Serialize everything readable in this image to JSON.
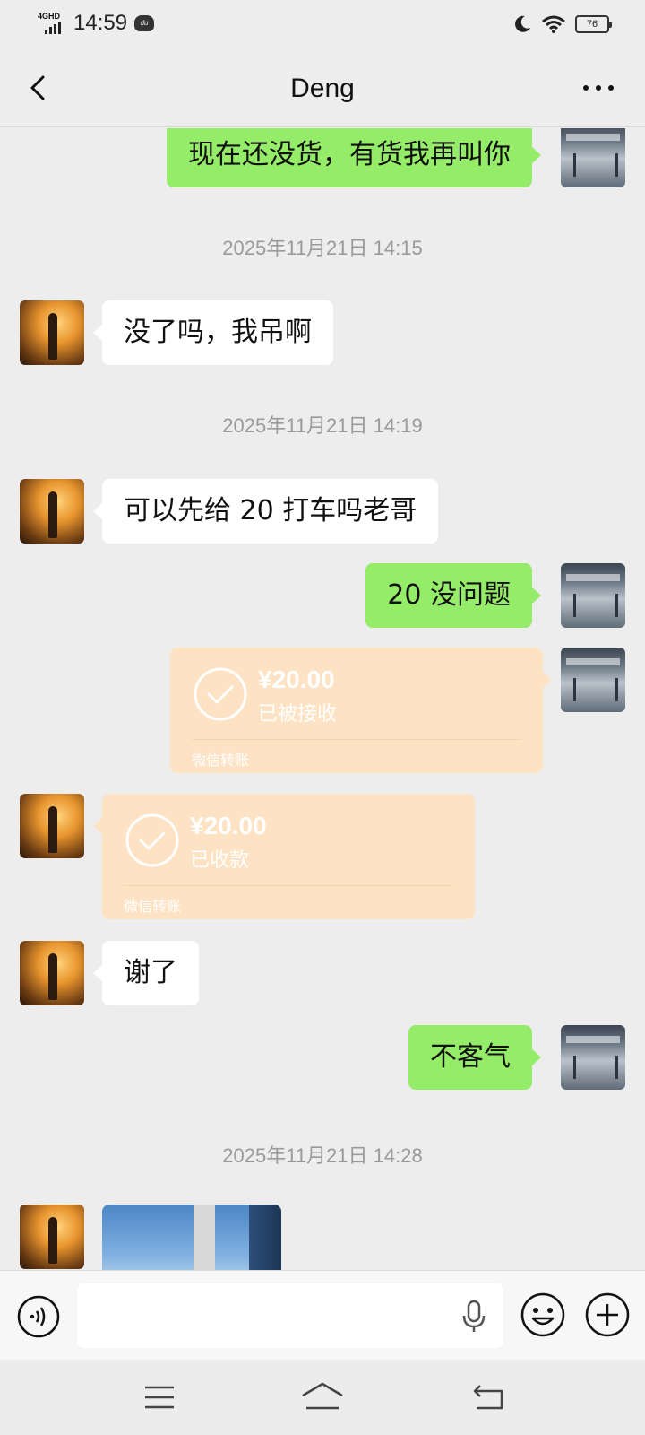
{
  "status_bar": {
    "network": "4GHD",
    "time": "14:59",
    "app_indicator": "du",
    "battery": "76",
    "icons": [
      "signal-icon",
      "app-notification-icon",
      "moon-icon",
      "wifi-icon",
      "battery-icon"
    ]
  },
  "header": {
    "title": "Deng",
    "back_icon": "chevron-left-icon",
    "more_icon": "more-icon"
  },
  "messages": [
    {
      "type": "text",
      "from": "self",
      "text": "现在还没货，有货我再叫你"
    },
    {
      "type": "timestamp",
      "text": "2025年11月21日 14:15"
    },
    {
      "type": "text",
      "from": "contact",
      "text": "没了吗，我吊啊"
    },
    {
      "type": "timestamp",
      "text": "2025年11月21日 14:19"
    },
    {
      "type": "text",
      "from": "contact",
      "text": "可以先给 20 打车吗老哥"
    },
    {
      "type": "text",
      "from": "self",
      "text": "20 没问题"
    },
    {
      "type": "transfer",
      "from": "self",
      "amount": "¥20.00",
      "status": "已被接收",
      "label": "微信转账"
    },
    {
      "type": "transfer",
      "from": "contact",
      "amount": "¥20.00",
      "status": "已收款",
      "label": "微信转账"
    },
    {
      "type": "text",
      "from": "contact",
      "text": "谢了"
    },
    {
      "type": "text",
      "from": "self",
      "text": "不客气"
    },
    {
      "type": "timestamp",
      "text": "2025年11月21日 14:28"
    },
    {
      "type": "image",
      "from": "contact"
    }
  ],
  "input_bar": {
    "placeholder": "",
    "icons": [
      "voice-icon",
      "microphone-icon",
      "emoji-icon",
      "plus-icon"
    ]
  },
  "system_nav": {
    "icons": [
      "menu-icon",
      "home-icon",
      "back-icon"
    ]
  },
  "colors": {
    "background": "#ededed",
    "sent_bubble": "#95ec69",
    "received_bubble": "#ffffff",
    "transfer_card": "#fde2c4",
    "timestamp": "#9a9a9a"
  }
}
